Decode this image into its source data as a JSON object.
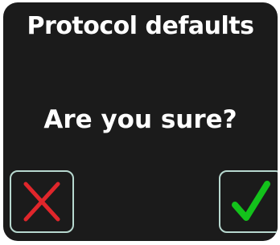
{
  "dialog": {
    "title": "Protocol defaults",
    "message": "Are you sure?",
    "cancel_icon": "x-icon",
    "confirm_icon": "checkmark-icon"
  },
  "colors": {
    "background": "#1b1b1b",
    "text": "#ffffff",
    "button_border": "#b7d8cf",
    "cancel": "#e0262b",
    "confirm": "#13c21b"
  }
}
